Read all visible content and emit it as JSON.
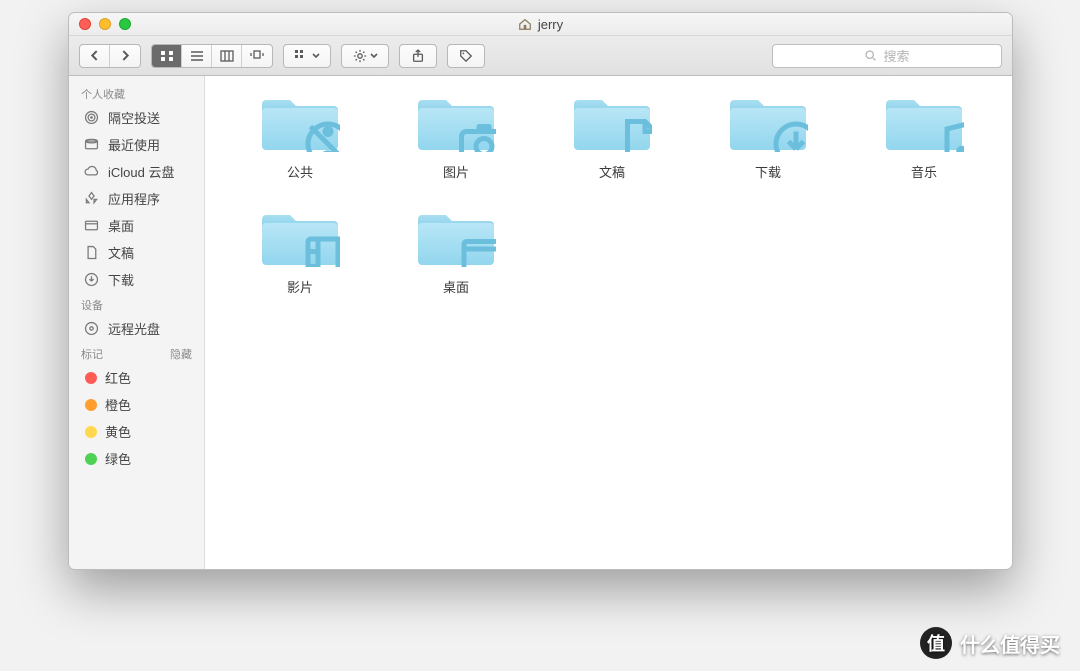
{
  "window": {
    "title": "jerry"
  },
  "toolbar": {
    "search_placeholder": "搜索"
  },
  "sidebar": {
    "favorites": {
      "header": "个人收藏",
      "items": [
        {
          "label": "隔空投送",
          "icon": "airdrop"
        },
        {
          "label": "最近使用",
          "icon": "clock"
        },
        {
          "label": "iCloud 云盘",
          "icon": "cloud"
        },
        {
          "label": "应用程序",
          "icon": "apps"
        },
        {
          "label": "桌面",
          "icon": "desktop"
        },
        {
          "label": "文稿",
          "icon": "doc"
        },
        {
          "label": "下载",
          "icon": "download"
        }
      ]
    },
    "devices": {
      "header": "设备",
      "items": [
        {
          "label": "远程光盘",
          "icon": "disc"
        }
      ]
    },
    "tags": {
      "header": "标记",
      "hide": "隐藏",
      "items": [
        {
          "label": "红色",
          "color": "#ff5b55"
        },
        {
          "label": "橙色",
          "color": "#ff9e2e"
        },
        {
          "label": "黄色",
          "color": "#ffd84c"
        },
        {
          "label": "绿色",
          "color": "#4fd253"
        }
      ]
    }
  },
  "folders": [
    {
      "label": "公共",
      "glyph": "public"
    },
    {
      "label": "图片",
      "glyph": "camera"
    },
    {
      "label": "文稿",
      "glyph": "doc"
    },
    {
      "label": "下载",
      "glyph": "download"
    },
    {
      "label": "音乐",
      "glyph": "music"
    },
    {
      "label": "影片",
      "glyph": "movie"
    },
    {
      "label": "桌面",
      "glyph": "desktop"
    }
  ],
  "watermark": {
    "badge": "值",
    "text": "什么值得买"
  }
}
